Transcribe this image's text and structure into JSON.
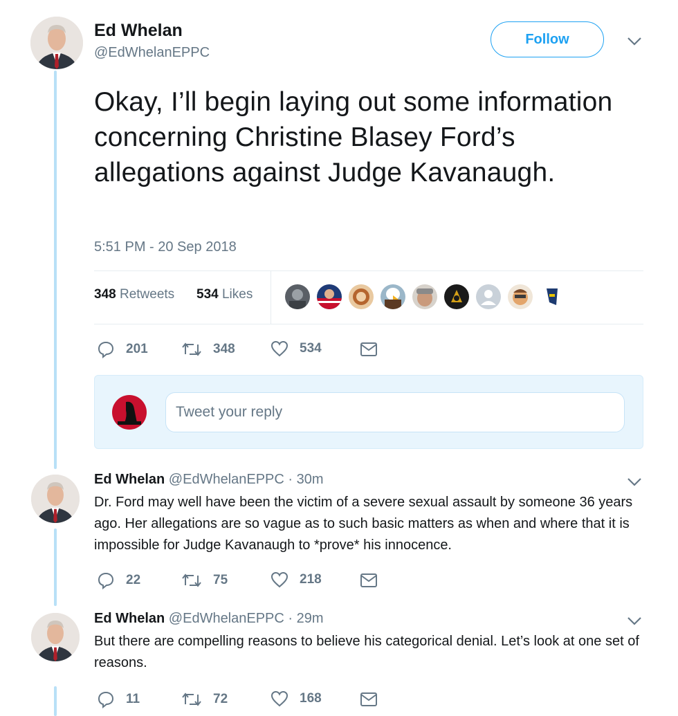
{
  "main_tweet": {
    "name": "Ed Whelan",
    "handle": "@EdWhelanEPPC",
    "follow_label": "Follow",
    "text": "Okay, I’ll begin laying out some information concerning Christine Blasey Ford’s allegations against Judge Kavanaugh.",
    "timestamp": "5:51 PM - 20 Sep 2018",
    "retweets_count": "348",
    "retweets_label": "Retweets",
    "likes_count": "534",
    "likes_label": "Likes",
    "actions": {
      "replies": "201",
      "retweets": "348",
      "likes": "534"
    }
  },
  "reply_box": {
    "placeholder": "Tweet your reply"
  },
  "replies": [
    {
      "name": "Ed Whelan",
      "handle": "@EdWhelanEPPC",
      "time": "· 30m",
      "text": "Dr. Ford may well have been the victim of a severe sexual assault by someone 36 years ago. Her allegations are so vague as to such basic matters as when and where that it is impossible for Judge Kavanaugh to *prove* his innocence.",
      "actions": {
        "replies": "22",
        "retweets": "75",
        "likes": "218"
      }
    },
    {
      "name": "Ed Whelan",
      "handle": "@EdWhelanEPPC",
      "time": "· 29m",
      "text": "But there are compelling reasons to believe his categorical denial. Let’s look at one set of reasons.",
      "actions": {
        "replies": "11",
        "retweets": "72",
        "likes": "168"
      }
    }
  ],
  "colors": {
    "accent": "#1da1f2",
    "muted": "#657786",
    "thread": "#b8e0f7"
  },
  "icons": [
    "reply-icon",
    "retweet-icon",
    "like-icon",
    "message-icon",
    "chevron-down-icon"
  ]
}
